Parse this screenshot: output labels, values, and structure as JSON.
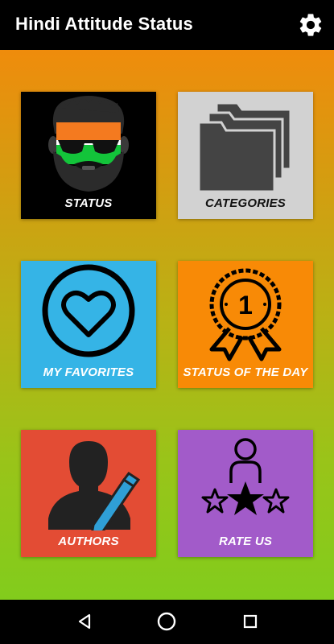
{
  "appbar": {
    "title": "Hindi Attitude Status",
    "settings_icon": "gear-icon"
  },
  "tiles": [
    {
      "label": "STATUS",
      "icon": "bearded-man-sunglasses-icon"
    },
    {
      "label": "CATEGORIES",
      "icon": "folders-icon"
    },
    {
      "label": "MY FAVORITES",
      "icon": "heart-circle-icon"
    },
    {
      "label": "STATUS OF THE DAY",
      "icon": "award-badge-icon",
      "badge_text": "1"
    },
    {
      "label": "AUTHORS",
      "icon": "author-pen-icon"
    },
    {
      "label": "RATE US",
      "icon": "person-stars-icon"
    }
  ],
  "navbar": {
    "back_icon": "back-triangle-icon",
    "home_icon": "home-circle-icon",
    "recents_icon": "recents-square-icon"
  },
  "colors": {
    "status_tile": "#000000",
    "categories_tile": "#d2d2d2",
    "favorites_tile": "#35b4e6",
    "day_tile": "#f88a06",
    "authors_tile": "#e34c34",
    "rate_tile": "#a25bc9",
    "gradient_top": "#ef8c0c",
    "gradient_bottom": "#82cc1c"
  }
}
